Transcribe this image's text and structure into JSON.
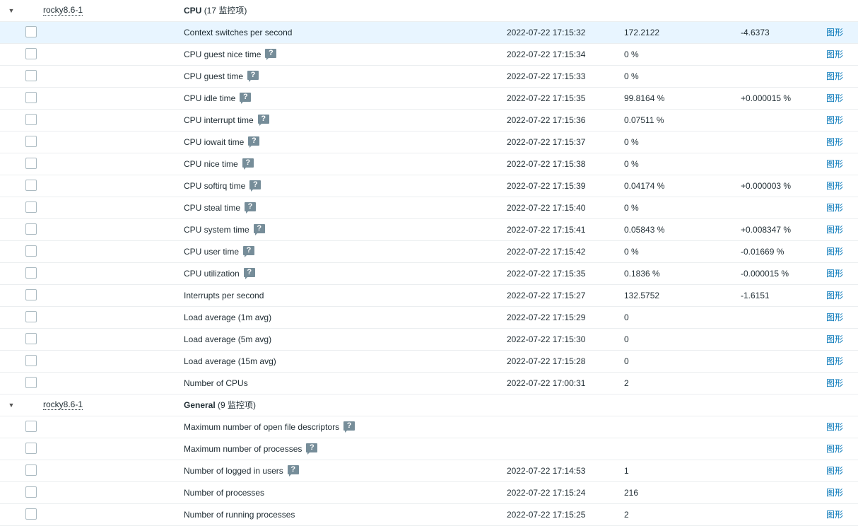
{
  "help_icon_glyph": "?",
  "colors": {
    "accent_link": "#0275b8",
    "row_highlight": "#e8f5ff",
    "help_icon_bg": "#768d99"
  },
  "groups": [
    {
      "host": "rocky8.6-1",
      "app": "CPU",
      "count_label": "(17 监控项)",
      "items": [
        {
          "name": "Context switches per second",
          "help": false,
          "time": "2022-07-22 17:15:32",
          "value": "172.2122",
          "change": "-4.6373",
          "graph": "图形",
          "highlighted": true
        },
        {
          "name": "CPU guest nice time",
          "help": true,
          "time": "2022-07-22 17:15:34",
          "value": "0 %",
          "change": "",
          "graph": "图形"
        },
        {
          "name": "CPU guest time",
          "help": true,
          "time": "2022-07-22 17:15:33",
          "value": "0 %",
          "change": "",
          "graph": "图形"
        },
        {
          "name": "CPU idle time",
          "help": true,
          "time": "2022-07-22 17:15:35",
          "value": "99.8164 %",
          "change": "+0.000015 %",
          "graph": "图形"
        },
        {
          "name": "CPU interrupt time",
          "help": true,
          "time": "2022-07-22 17:15:36",
          "value": "0.07511 %",
          "change": "",
          "graph": "图形"
        },
        {
          "name": "CPU iowait time",
          "help": true,
          "time": "2022-07-22 17:15:37",
          "value": "0 %",
          "change": "",
          "graph": "图形"
        },
        {
          "name": "CPU nice time",
          "help": true,
          "time": "2022-07-22 17:15:38",
          "value": "0 %",
          "change": "",
          "graph": "图形"
        },
        {
          "name": "CPU softirq time",
          "help": true,
          "time": "2022-07-22 17:15:39",
          "value": "0.04174 %",
          "change": "+0.000003 %",
          "graph": "图形"
        },
        {
          "name": "CPU steal time",
          "help": true,
          "time": "2022-07-22 17:15:40",
          "value": "0 %",
          "change": "",
          "graph": "图形"
        },
        {
          "name": "CPU system time",
          "help": true,
          "time": "2022-07-22 17:15:41",
          "value": "0.05843 %",
          "change": "+0.008347 %",
          "graph": "图形"
        },
        {
          "name": "CPU user time",
          "help": true,
          "time": "2022-07-22 17:15:42",
          "value": "0 %",
          "change": "-0.01669 %",
          "graph": "图形"
        },
        {
          "name": "CPU utilization",
          "help": true,
          "time": "2022-07-22 17:15:35",
          "value": "0.1836 %",
          "change": "-0.000015 %",
          "graph": "图形"
        },
        {
          "name": "Interrupts per second",
          "help": false,
          "time": "2022-07-22 17:15:27",
          "value": "132.5752",
          "change": "-1.6151",
          "graph": "图形"
        },
        {
          "name": "Load average (1m avg)",
          "help": false,
          "time": "2022-07-22 17:15:29",
          "value": "0",
          "change": "",
          "graph": "图形"
        },
        {
          "name": "Load average (5m avg)",
          "help": false,
          "time": "2022-07-22 17:15:30",
          "value": "0",
          "change": "",
          "graph": "图形"
        },
        {
          "name": "Load average (15m avg)",
          "help": false,
          "time": "2022-07-22 17:15:28",
          "value": "0",
          "change": "",
          "graph": "图形"
        },
        {
          "name": "Number of CPUs",
          "help": false,
          "time": "2022-07-22 17:00:31",
          "value": "2",
          "change": "",
          "graph": "图形"
        }
      ]
    },
    {
      "host": "rocky8.6-1",
      "app": "General",
      "count_label": "(9 监控项)",
      "items": [
        {
          "name": "Maximum number of open file descriptors",
          "help": true,
          "time": "",
          "value": "",
          "change": "",
          "graph": "图形"
        },
        {
          "name": "Maximum number of processes",
          "help": true,
          "time": "",
          "value": "",
          "change": "",
          "graph": "图形"
        },
        {
          "name": "Number of logged in users",
          "help": true,
          "time": "2022-07-22 17:14:53",
          "value": "1",
          "change": "",
          "graph": "图形"
        },
        {
          "name": "Number of processes",
          "help": false,
          "time": "2022-07-22 17:15:24",
          "value": "216",
          "change": "",
          "graph": "图形"
        },
        {
          "name": "Number of running processes",
          "help": false,
          "time": "2022-07-22 17:15:25",
          "value": "2",
          "change": "",
          "graph": "图形"
        }
      ]
    }
  ]
}
